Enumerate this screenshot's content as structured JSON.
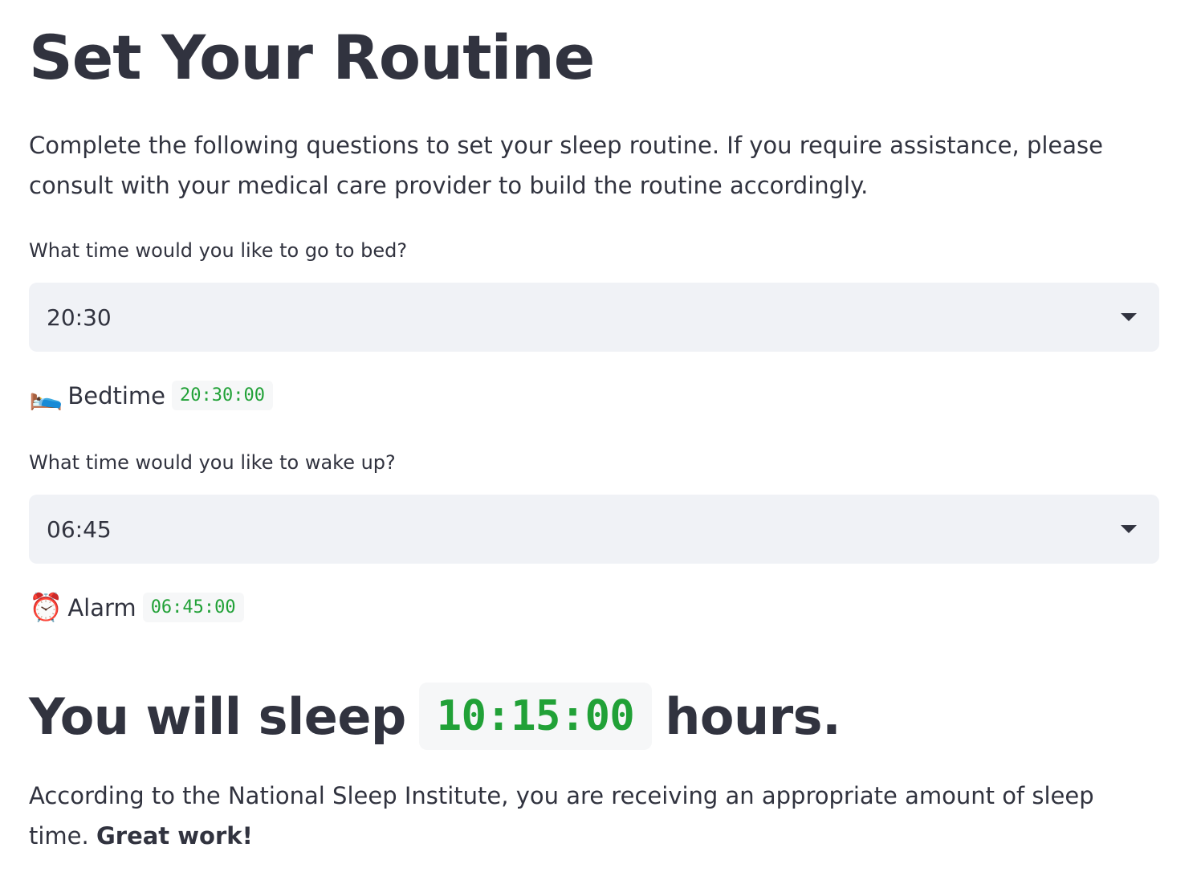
{
  "title": "Set Your Routine",
  "intro": "Complete the following questions to set your sleep routine. If you require assistance, please consult with your medical care provider to build the routine accordingly.",
  "bedtime_question": {
    "label": "What time would you like to go to bed?",
    "selected_value": "20:30"
  },
  "bedtime_readout": {
    "emoji": "🛌",
    "label": "Bedtime",
    "value": "20:30:00"
  },
  "wake_question": {
    "label": "What time would you like to wake up?",
    "selected_value": "06:45"
  },
  "alarm_readout": {
    "emoji": "⏰",
    "label": "Alarm",
    "value": "06:45:00"
  },
  "result": {
    "prefix": "You will sleep",
    "duration": "10:15:00",
    "suffix": "hours."
  },
  "verdict": {
    "text": "According to the National Sleep Institute, you are receiving an appropriate amount of sleep time.",
    "emphasis": "Great work!"
  },
  "colors": {
    "text": "#31333f",
    "code_green": "#21a137",
    "select_bg": "#f0f2f6"
  }
}
